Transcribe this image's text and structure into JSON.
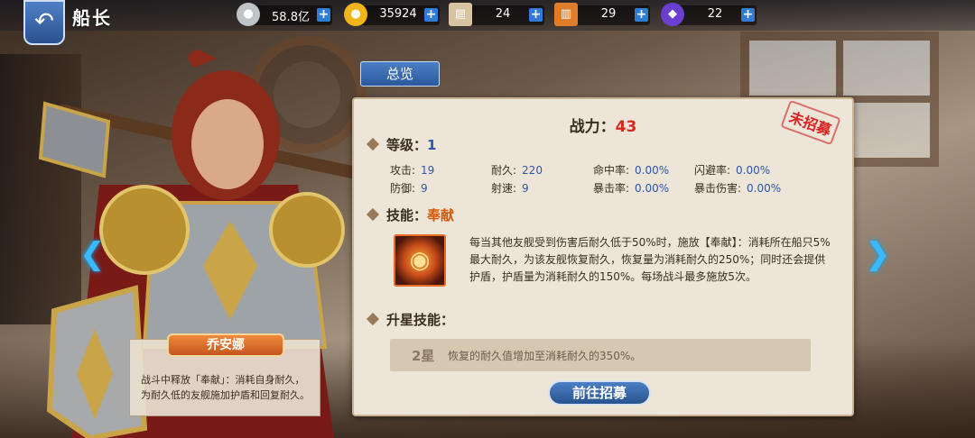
{
  "header": {
    "title": "船长"
  },
  "resources": [
    {
      "icon": "silver-coin-icon",
      "value": "58.8亿",
      "color": "#bfc4c9"
    },
    {
      "icon": "gold-coin-icon",
      "value": "35924",
      "color": "#f1b51c"
    },
    {
      "icon": "scroll-icon",
      "value": "24",
      "color": "#d8c4a0"
    },
    {
      "icon": "card-icon",
      "value": "29",
      "color": "#e07d2a"
    },
    {
      "icon": "gem-icon",
      "value": "22",
      "color": "#6a3fd0"
    }
  ],
  "tab": {
    "label": "总览"
  },
  "hero": {
    "name": "乔安娜",
    "description": "战斗中释放「奉献」：消耗自身耐久，为耐久低的友舰施加护盾和回复耐久。"
  },
  "panel": {
    "power_label": "战力：",
    "power_value": "43",
    "stamp": "未招募",
    "level_label": "等级：",
    "level_value": "1",
    "stats": [
      {
        "label": "攻击:",
        "value": "19"
      },
      {
        "label": "耐久:",
        "value": "220"
      },
      {
        "label": "命中率:",
        "value": "0.00%"
      },
      {
        "label": "闪避率:",
        "value": "0.00%"
      },
      {
        "label": "防御:",
        "value": "9"
      },
      {
        "label": "射速:",
        "value": "9"
      },
      {
        "label": "暴击率:",
        "value": "0.00%"
      },
      {
        "label": "暴击伤害:",
        "value": "0.00%"
      }
    ],
    "skill_label": "技能：",
    "skill_name": "奉献",
    "skill_desc": "每当其他友舰受到伤害后耐久低于50%时，施放【奉献】：消耗所在船只5%最大耐久，为该友舰恢复耐久，恢复量为消耗耐久的250%；同时还会提供护盾，护盾量为消耗耐久的150%。每场战斗最多施放5次。",
    "star_label": "升星技能：",
    "star_level": "2星",
    "star_desc": "恢复的耐久值增加至消耗耐久的350%。",
    "recruit_button": "前往招募"
  },
  "colors": {
    "accent_blue": "#2a5a9d",
    "power_red": "#d4281e",
    "skill_orange": "#d4580a"
  }
}
